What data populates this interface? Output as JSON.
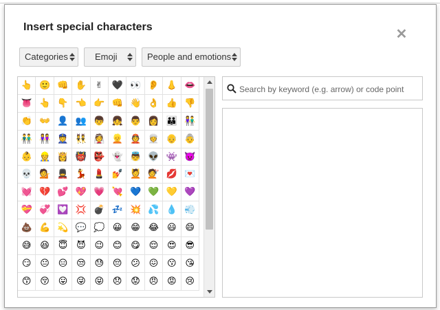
{
  "dialog": {
    "title": "Insert special characters",
    "close_glyph": "✕"
  },
  "dropdowns": {
    "category_type": "Categories",
    "character_set": "Emoji",
    "subcategory": "People and emotions"
  },
  "search": {
    "placeholder": "Search by keyword (e.g. arrow) or code point",
    "value": ""
  },
  "grid_cells": [
    "👆",
    "🙂",
    "👊",
    "✋",
    "✌",
    "🖤",
    "👀",
    "👂",
    "👃",
    "👄",
    "👅",
    "👆",
    "👇",
    "👈",
    "👉",
    "👊",
    "👋",
    "👌",
    "👍",
    "👎",
    "👏",
    "👐",
    "👤",
    "👥",
    "👦",
    "👧",
    "👨",
    "👩",
    "👪",
    "👫",
    "👬",
    "👭",
    "👮",
    "👯",
    "👰",
    "👱",
    "👲",
    "👳",
    "👴",
    "👵",
    "👶",
    "👷",
    "👸",
    "👹",
    "👺",
    "👻",
    "👼",
    "👽",
    "👾",
    "👿",
    "💀",
    "💁",
    "💂",
    "💃",
    "💄",
    "💅",
    "💆",
    "💇",
    "💋",
    "💌",
    "💓",
    "💔",
    "💕",
    "💖",
    "💗",
    "💘",
    "💙",
    "💚",
    "💛",
    "💜",
    "💝",
    "💞",
    "💟",
    "💢",
    "💣",
    "💤",
    "💥",
    "💦",
    "💧",
    "💨",
    "💩",
    "💪",
    "💫",
    "💬",
    "💭",
    "😀",
    "😁",
    "😂",
    "😃",
    "😄",
    "😅",
    "😆",
    "😇",
    "😈",
    "😉",
    "😊",
    "😋",
    "😌",
    "😍",
    "😎",
    "😏",
    "😐",
    "😑",
    "😒",
    "😓",
    "😔",
    "😕",
    "😖",
    "😗",
    "😘",
    "😙",
    "😚",
    "😛",
    "😜",
    "😝",
    "😞",
    "😟",
    "😠",
    "😡",
    "😢"
  ]
}
